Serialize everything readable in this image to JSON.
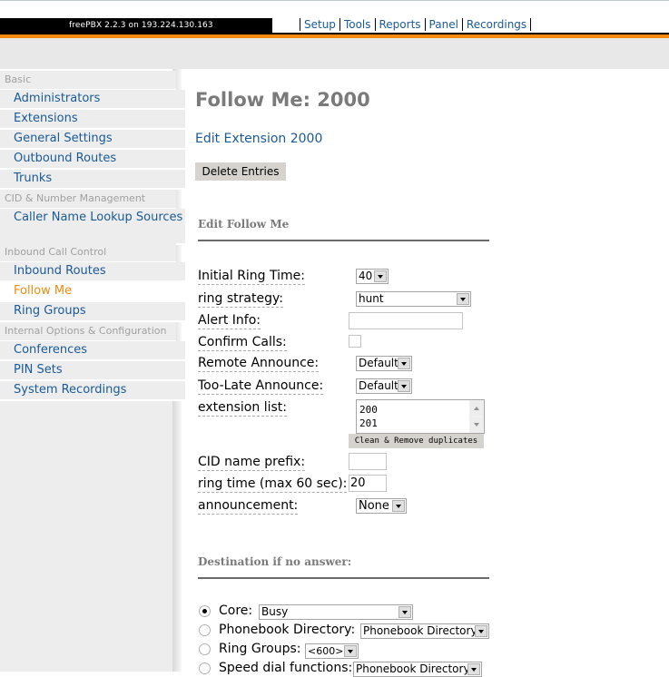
{
  "header": {
    "brand": "freePBX 2.2.3 on 193.224.130.163",
    "nav": [
      "Setup",
      "Tools",
      "Reports",
      "Panel",
      "Recordings"
    ]
  },
  "sidebar": {
    "sections": [
      {
        "category": "Basic",
        "items": [
          "Administrators",
          "Extensions",
          "General Settings",
          "Outbound Routes",
          "Trunks"
        ]
      },
      {
        "category": "CID & Number Management",
        "items": [
          "Caller Name Lookup Sources"
        ]
      },
      {
        "category": "Inbound Call Control",
        "items": [
          "Inbound Routes",
          "Follow Me",
          "Ring Groups"
        ]
      },
      {
        "category": "Internal Options & Configuration",
        "items": [
          "Conferences",
          "PIN Sets",
          "System Recordings"
        ]
      }
    ],
    "active_item": "Follow Me"
  },
  "main": {
    "title": "Follow Me: 2000",
    "edit_link": "Edit Extension 2000",
    "delete_button": "Delete Entries",
    "edit_section_title": "Edit Follow Me",
    "fields": {
      "initial_ring_time": {
        "label": "Initial Ring Time:",
        "value": "40"
      },
      "ring_strategy": {
        "label": "ring strategy:",
        "value": "hunt"
      },
      "alert_info": {
        "label": "Alert Info:",
        "value": ""
      },
      "confirm_calls": {
        "label": "Confirm Calls:",
        "checked": false
      },
      "remote_announce": {
        "label": "Remote Announce:",
        "value": "Default"
      },
      "too_late_announce": {
        "label": "Too-Late Announce:",
        "value": "Default"
      },
      "extension_list": {
        "label": "extension list:",
        "values": [
          "200",
          "201"
        ]
      },
      "clean_button": "Clean & Remove duplicates",
      "cid_name_prefix": {
        "label": "CID name prefix:",
        "value": ""
      },
      "ring_time": {
        "label": "ring time (max 60 sec):",
        "value": "20"
      },
      "announcement": {
        "label": "announcement:",
        "value": "None"
      }
    },
    "destination_section_title": "Destination if no answer:",
    "destinations": [
      {
        "label": "Core:",
        "value": "Busy",
        "selected": true
      },
      {
        "label": "Phonebook Directory:",
        "value": "Phonebook Directory",
        "selected": false
      },
      {
        "label": "Ring Groups:",
        "value": "<600>",
        "selected": false
      },
      {
        "label": "Speed dial functions:",
        "value": "Phonebook Directory",
        "selected": false
      }
    ]
  }
}
